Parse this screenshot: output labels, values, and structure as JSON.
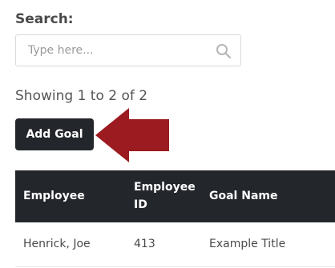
{
  "search": {
    "label": "Search:",
    "placeholder": "Type here...",
    "value": ""
  },
  "info": {
    "showing": "Showing 1 to 2 of 2"
  },
  "toolbar": {
    "add_goal_label": "Add Goal"
  },
  "annotation": {
    "arrow_color": "#9b1b20"
  },
  "table": {
    "headers": {
      "employee": "Employee",
      "employee_id": "Employee ID",
      "goal_name": "Goal Name"
    },
    "rows": [
      {
        "employee": "Henrick, Joe",
        "employee_id": "413",
        "goal_name": "Example Title"
      }
    ]
  },
  "colors": {
    "button_bg": "#23262b",
    "header_bg": "#23262b"
  }
}
